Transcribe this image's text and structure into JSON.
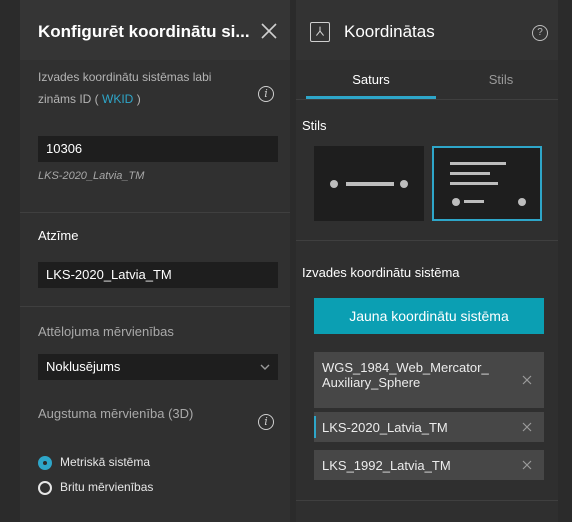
{
  "left_panel": {
    "title": "Konfigurēt koordinātu si...",
    "wkid_desc_line1": "Izvades koordinātu sistēmas labi",
    "wkid_desc_prefix": "zināms ID (",
    "wkid_link": " WKID ",
    "wkid_desc_suffix": ")",
    "wkid_value": "10306",
    "wkid_resolved": "LKS-2020_Latvia_TM",
    "label_title": "Atzīme",
    "label_value": "LKS-2020_Latvia_TM",
    "display_units_title": "Attēlojuma mērvienības",
    "display_units_value": "Noklusējums",
    "elevation_title": "Augstuma mērvienība (3D)",
    "elevation_options": [
      "Metriskā sistēma",
      "Britu mērvienības"
    ]
  },
  "right_panel": {
    "title": "Koordinātas",
    "tabs": [
      "Saturs",
      "Stils"
    ],
    "style_section_title": "Stils",
    "output_cs_title": "Izvades koordinātu sistēma",
    "add_button": "Jauna koordinātu sistēma",
    "coordinate_systems": [
      "WGS_1984_Web_Mercator_ Auxiliary_Sphere",
      "LKS-2020_Latvia_TM",
      "LKS_1992_Latvia_TM"
    ]
  },
  "colors": {
    "accent": "#2ea6c9",
    "button": "#0b9fb3",
    "background": "#2b2b2b"
  }
}
